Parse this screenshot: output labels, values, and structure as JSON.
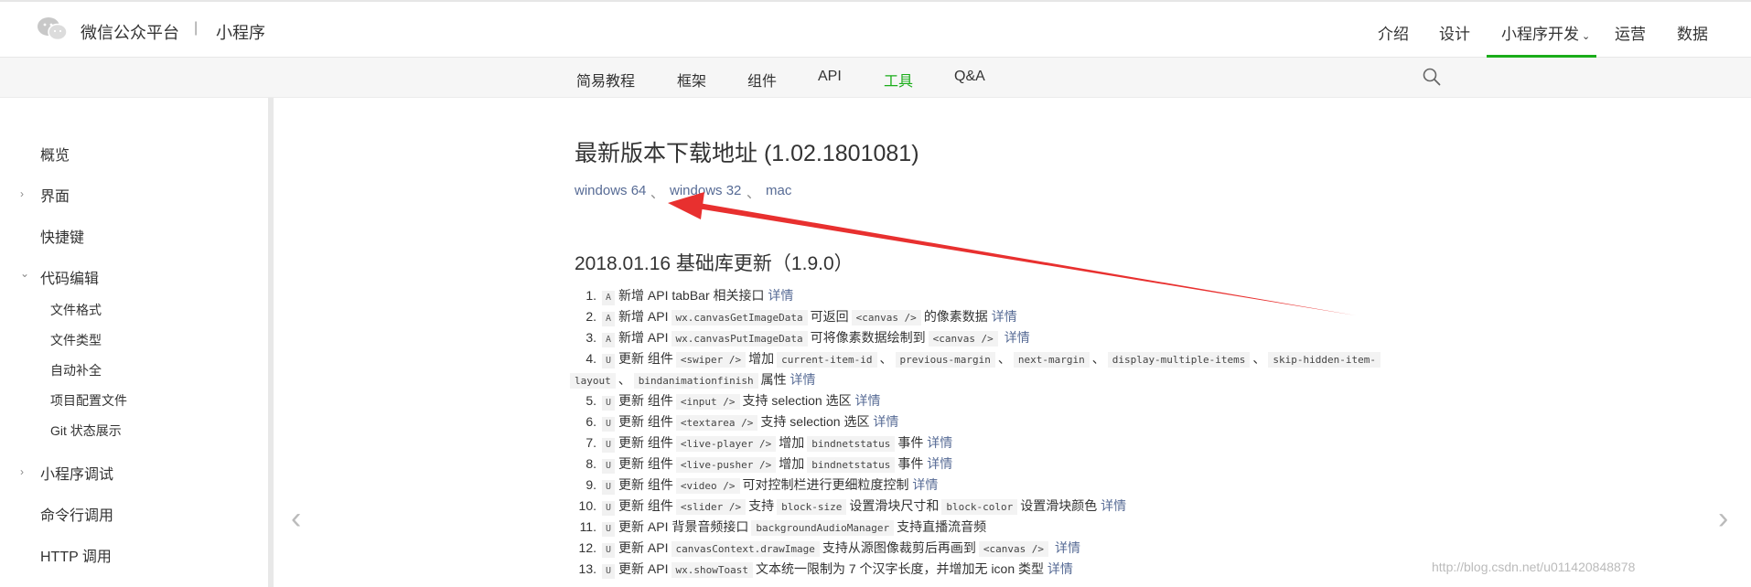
{
  "header": {
    "brand": "微信公众平台",
    "separator": "|",
    "product": "小程序",
    "nav": [
      "介绍",
      "设计",
      "小程序开发",
      "运营",
      "数据"
    ],
    "active_nav": "小程序开发"
  },
  "subnav": {
    "items": [
      "简易教程",
      "框架",
      "组件",
      "API",
      "工具",
      "Q&A"
    ],
    "active": "工具"
  },
  "sidebar": {
    "items": [
      {
        "label": "概览"
      },
      {
        "label": "界面"
      },
      {
        "label": "快捷键"
      },
      {
        "label": "代码编辑"
      },
      {
        "label": "文件格式"
      },
      {
        "label": "文件类型"
      },
      {
        "label": "自动补全"
      },
      {
        "label": "项目配置文件"
      },
      {
        "label": "Git 状态展示"
      },
      {
        "label": "小程序调试"
      },
      {
        "label": "命令行调用"
      },
      {
        "label": "HTTP 调用"
      }
    ]
  },
  "main": {
    "title": "最新版本下载地址 (1.02.1801081)",
    "downloads": [
      "windows 64",
      "windows 32",
      "mac"
    ],
    "download_sep": "、",
    "section_title": "2018.01.16 基础库更新（1.9.0）",
    "detail_label": "详情",
    "items": [
      {
        "num": "1.",
        "tag": "A",
        "t1": "新增 API tabBar 相关接口"
      },
      {
        "num": "2.",
        "tag": "A",
        "t1": "新增 API",
        "c1": "wx.canvasGetImageData",
        "t2": "可返回",
        "c2": "<canvas />",
        "t3": "的像素数据"
      },
      {
        "num": "3.",
        "tag": "A",
        "t1": "新增 API",
        "c1": "wx.canvasPutImageData",
        "t2": "可将像素数据绘制到",
        "c2": "<canvas />"
      },
      {
        "num": "4.",
        "tag": "U",
        "t1": "更新 组件",
        "c1": "<swiper />",
        "t2": "增加",
        "c2": "current-item-id",
        "s1": "、",
        "c3": "previous-margin",
        "s2": "、",
        "c4": "next-margin",
        "s3": "、",
        "c5": "display-multiple-items",
        "s4": "、",
        "c6": "skip-hidden-item-"
      },
      {
        "num": "",
        "c1": "layout",
        "s1": "、",
        "c2": "bindanimationfinish",
        "t1": "属性"
      },
      {
        "num": "5.",
        "tag": "U",
        "t1": "更新 组件",
        "c1": "<input />",
        "t2": "支持 selection 选区"
      },
      {
        "num": "6.",
        "tag": "U",
        "t1": "更新 组件",
        "c1": "<textarea />",
        "t2": "支持 selection 选区"
      },
      {
        "num": "7.",
        "tag": "U",
        "t1": "更新 组件",
        "c1": "<live-player />",
        "t2": "增加",
        "c2": "bindnetstatus",
        "t3": "事件"
      },
      {
        "num": "8.",
        "tag": "U",
        "t1": "更新 组件",
        "c1": "<live-pusher />",
        "t2": "增加",
        "c2": "bindnetstatus",
        "t3": "事件"
      },
      {
        "num": "9.",
        "tag": "U",
        "t1": "更新 组件",
        "c1": "<video />",
        "t2": "可对控制栏进行更细粒度控制"
      },
      {
        "num": "10.",
        "tag": "U",
        "t1": "更新 组件",
        "c1": "<slider />",
        "t2": "支持",
        "c2": "block-size",
        "t3": "设置滑块尺寸和",
        "c3": "block-color",
        "t4": "设置滑块颜色"
      },
      {
        "num": "11.",
        "tag": "U",
        "t1": "更新 API 背景音频接口",
        "c1": "backgroundAudioManager",
        "t2": "支持直播流音频"
      },
      {
        "num": "12.",
        "tag": "U",
        "t1": "更新 API",
        "c1": "canvasContext.drawImage",
        "t2": "支持从源图像裁剪后再画到",
        "c2": "<canvas />"
      },
      {
        "num": "13.",
        "tag": "U",
        "t1": "更新 API",
        "c1": "wx.showToast",
        "t2": "文本统一限制为 7 个汉字长度，并增加无 icon 类型"
      }
    ]
  },
  "pager": {
    "prev": "‹",
    "next": "›"
  },
  "watermark": "http://blog.csdn.net/u011420848878",
  "colors": {
    "accent": "#1aad19",
    "link": "#576b95",
    "arrow": "#e8302f"
  }
}
